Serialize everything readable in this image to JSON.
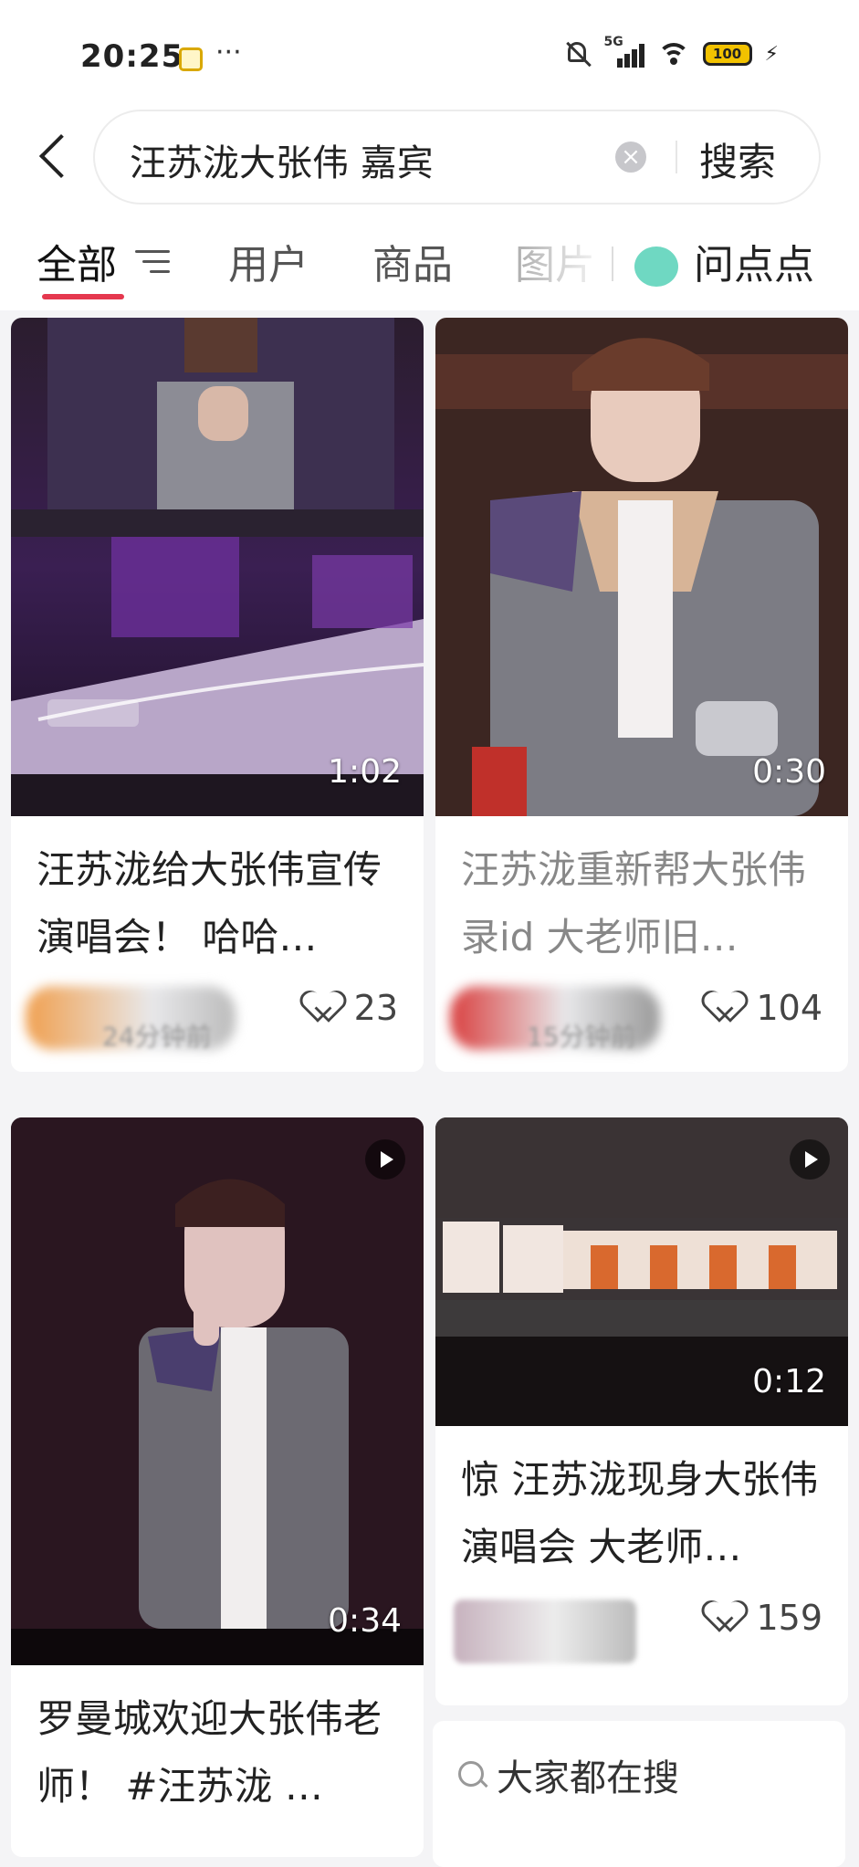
{
  "status_bar": {
    "time": "20:25",
    "dots": "···",
    "network": "5G",
    "battery": "100"
  },
  "search": {
    "query": "汪苏泷大张伟 嘉宾",
    "submit_label": "搜索",
    "clear_symbol": "×"
  },
  "tabs": [
    {
      "label": "全部",
      "active": true
    },
    {
      "label": "用户"
    },
    {
      "label": "商品"
    },
    {
      "label": "图片"
    }
  ],
  "ask_tab": {
    "label": "问点点",
    "color": "#6fd8c2"
  },
  "accent_color": "#e5384e",
  "cards": [
    {
      "title": "汪苏泷给大张伟宣传演唱会！ 哈哈…",
      "duration": "1:02",
      "likes": "23",
      "time": "24分钟前",
      "visited": false
    },
    {
      "title": "汪苏泷重新帮大张伟录id 大老师旧…",
      "duration": "0:30",
      "likes": "104",
      "time": "15分钟前",
      "visited": true
    },
    {
      "title": "罗曼城欢迎大张伟老师！ #汪苏泷 …",
      "duration": "0:34",
      "likes": "",
      "time": "",
      "visited": false
    },
    {
      "title": "惊 汪苏泷现身大张伟演唱会 大老师…",
      "duration": "0:12",
      "likes": "159",
      "time": "",
      "visited": false
    }
  ],
  "suggest": {
    "label": "大家都在搜"
  }
}
